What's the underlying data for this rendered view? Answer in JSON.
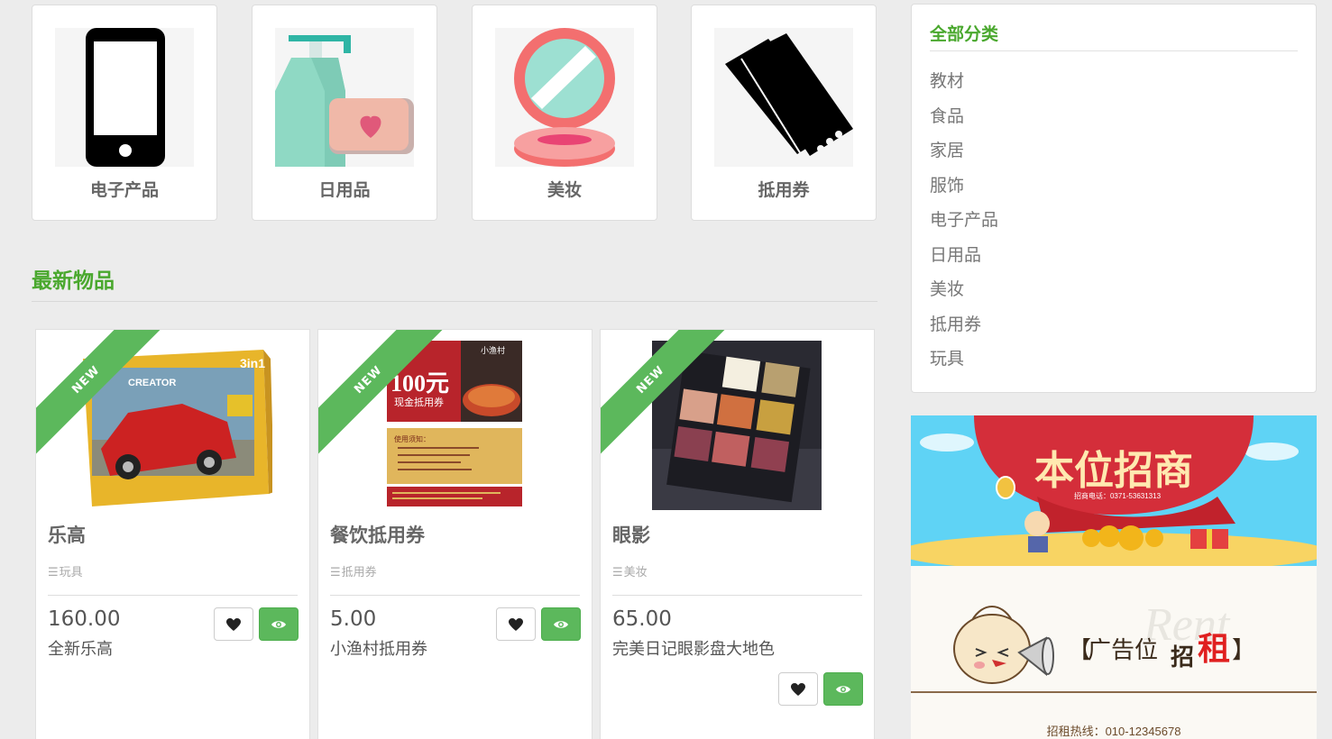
{
  "categories": [
    {
      "label": "电子产品",
      "icon": "phone-icon"
    },
    {
      "label": "日用品",
      "icon": "daily-goods-icon"
    },
    {
      "label": "美妆",
      "icon": "compact-mirror-icon"
    },
    {
      "label": "抵用券",
      "icon": "ticket-icon"
    }
  ],
  "latest": {
    "title": "最新物品",
    "ribbon": "NEW",
    "items": [
      {
        "title": "乐高",
        "category": "玩具",
        "price": "160.00",
        "desc": "全新乐高",
        "image_text": "CREATOR"
      },
      {
        "title": "餐饮抵用券",
        "category": "抵用券",
        "price": "5.00",
        "desc": "小渔村抵用券",
        "image_text": "100元",
        "image_text2": "现金抵用券",
        "image_text3": "小渔村",
        "image_text4": "使用须知："
      },
      {
        "title": "眼影",
        "category": "美妆",
        "price": "65.00",
        "desc": "完美日记眼影盘大地色"
      }
    ]
  },
  "sidebar": {
    "title": "全部分类",
    "items": [
      "教材",
      "食品",
      "家居",
      "服饰",
      "电子产品",
      "日用品",
      "美妆",
      "抵用券",
      "玩具"
    ]
  },
  "ads": {
    "ad1_title": "本位招商",
    "ad1_phone": "招商电话：0371-53631313",
    "ad2_bracket_left": "【",
    "ad2_text": "广告位",
    "ad2_zhao": "招",
    "ad2_zu": "租",
    "ad2_bracket_right": "】",
    "ad2_watermark": "Rent",
    "ad2_hotline": "招租热线：010-12345678"
  },
  "colors": {
    "accent": "#4aa82e",
    "button_green": "#5cb85c"
  }
}
